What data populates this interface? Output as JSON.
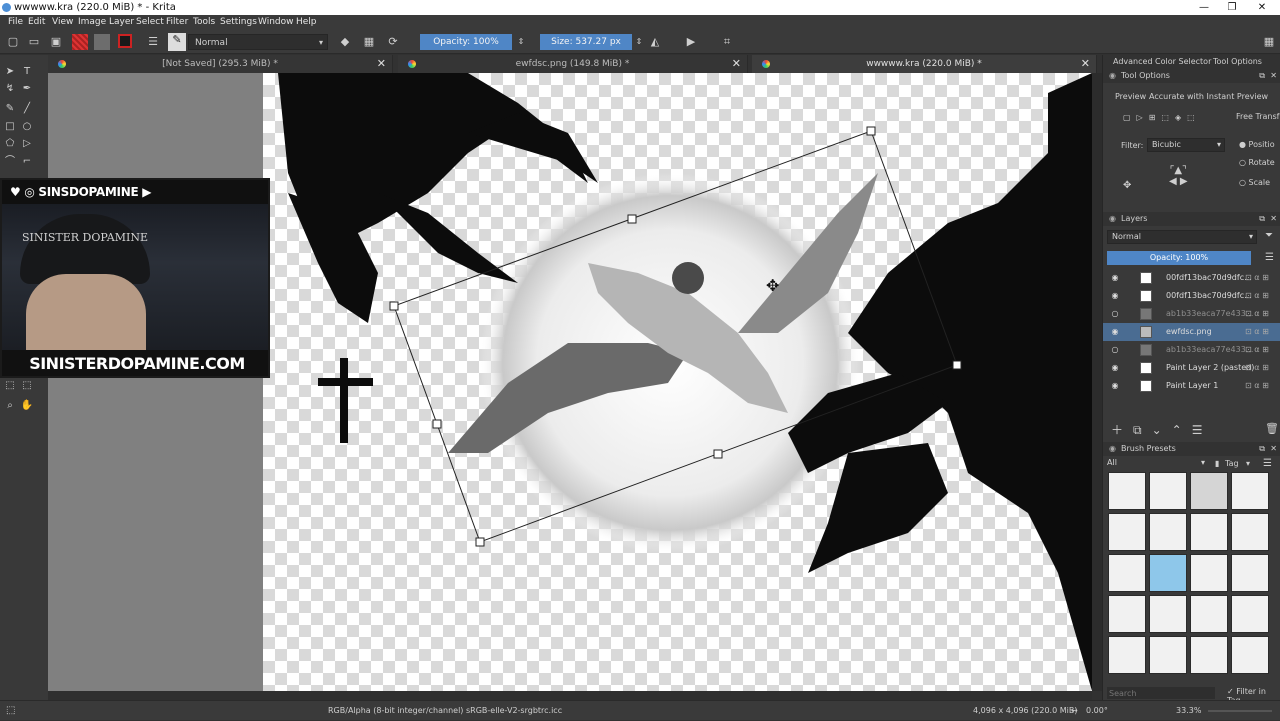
{
  "window": {
    "title": "wwwww.kra (220.0 MiB) * - Krita",
    "minimize": "—",
    "maximize": "❐",
    "close": "✕"
  },
  "menu": [
    "File",
    "Edit",
    "View",
    "Image",
    "Layer",
    "Select",
    "Filter",
    "Tools",
    "Settings",
    "Window",
    "Help"
  ],
  "toolbar": {
    "blend_mode": "Normal",
    "opacity": "Opacity: 100%",
    "size": "Size: 537.27 px"
  },
  "tabs": [
    {
      "label": "[Not Saved]  (295.3 MiB) *",
      "close": "✕"
    },
    {
      "label": "ewfdsc.png  (149.8 MiB) *",
      "close": "✕"
    },
    {
      "label": "wwwww.kra  (220.0 MiB) *",
      "close": "✕"
    }
  ],
  "webcam": {
    "top_text": "♥ ◎ SINSDOPAMINE ▶ SINISTERDOPAMINE",
    "bottom_text": "SINISTERDOPAMINE.COM",
    "logo": "SINISTER DOPAMINE"
  },
  "dock": {
    "tabs": [
      "Advanced Color Selector",
      "Tool Options"
    ],
    "tool_options_title": "Tool Options",
    "preview_label": "Preview",
    "preview_value": "Accurate with Instant Preview",
    "mode": "Free Transf",
    "filter_label": "Filter:",
    "filter_value": "Bicubic",
    "radio_options": [
      "Positio",
      "Rotate",
      "Scale"
    ],
    "layers_title": "Layers",
    "layers_blend": "Normal",
    "layers_opacity": "Opacity: 100%",
    "layers": [
      {
        "name": "00fdf13bac70d9dfc...",
        "visible": true,
        "dim": false,
        "selected": false
      },
      {
        "name": "00fdf13bac70d9dfc...",
        "visible": true,
        "dim": false,
        "selected": false
      },
      {
        "name": "ab1b33eaca77e433...",
        "visible": false,
        "dim": true,
        "selected": false
      },
      {
        "name": "ewfdsc.png",
        "visible": true,
        "dim": false,
        "selected": true
      },
      {
        "name": "ab1b33eaca77e433...",
        "visible": false,
        "dim": true,
        "selected": false
      },
      {
        "name": "Paint Layer 2 (pasted)",
        "visible": true,
        "dim": false,
        "selected": false
      },
      {
        "name": "Paint Layer 1",
        "visible": true,
        "dim": false,
        "selected": false
      }
    ],
    "brush_presets_title": "Brush Presets",
    "brush_filter": "All",
    "brush_tag": "Tag",
    "search_placeholder": "Search",
    "filter_in_tag": "Filter in Tag"
  },
  "status": {
    "color_info": "RGB/Alpha (8-bit integer/channel)  sRGB-elle-V2-srgbtrc.icc",
    "image_size": "4,096 x 4,096 (220.0 MiB)",
    "rotation": "0.00°",
    "zoom": "33.3%"
  }
}
